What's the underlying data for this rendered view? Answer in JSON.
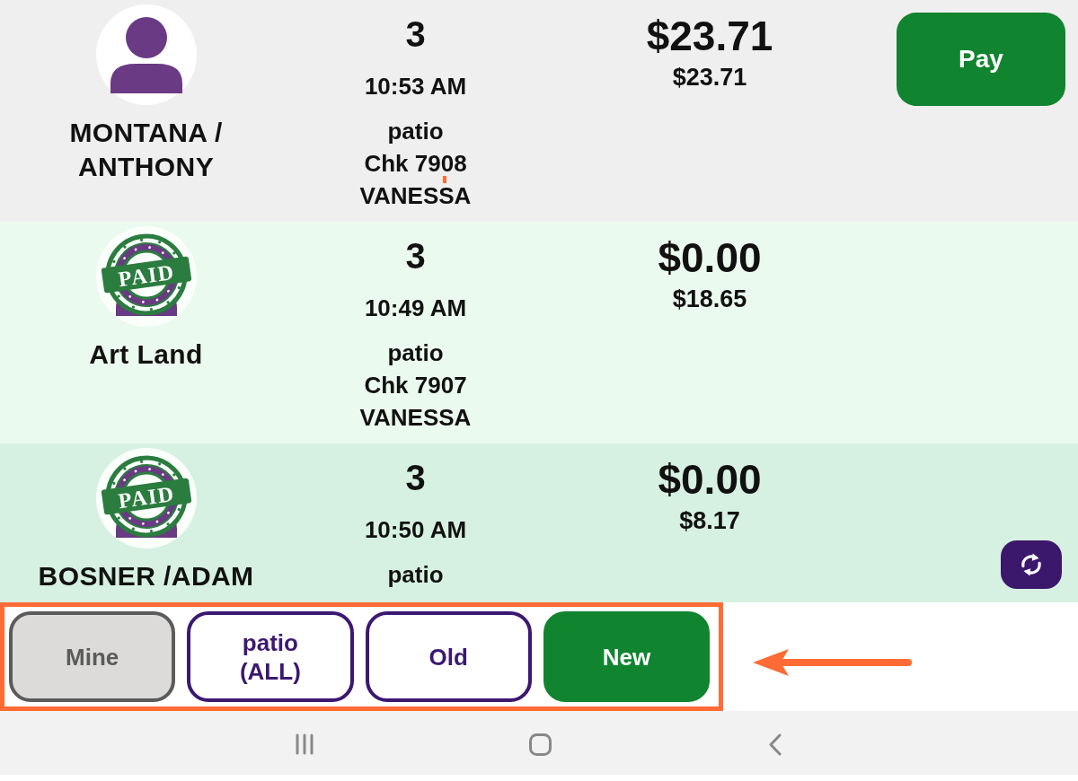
{
  "orders": [
    {
      "paid": false,
      "customer": "MONTANA / ANTHONY",
      "guests": "3",
      "time": "10:53 AM",
      "area": "patio",
      "check": "Chk 7908",
      "server": "VANESSA",
      "balance": "$23.71",
      "total": "$23.71",
      "pay_button": "Pay"
    },
    {
      "paid": true,
      "stamp": "PAID",
      "customer": "Art Land",
      "guests": "3",
      "time": "10:49 AM",
      "area": "patio",
      "check": "Chk 7907",
      "server": "VANESSA",
      "balance": "$0.00",
      "total": "$18.65"
    },
    {
      "paid": true,
      "stamp": "PAID",
      "customer": "BOSNER /ADAM",
      "guests": "3",
      "time": "10:50 AM",
      "area": "patio",
      "balance": "$0.00",
      "total": "$8.17"
    }
  ],
  "filter_buttons": [
    {
      "label": "Mine",
      "kind": "muted"
    },
    {
      "label": "patio (ALL)",
      "kind": "outline"
    },
    {
      "label": "Old",
      "kind": "outline"
    },
    {
      "label": "New",
      "kind": "primary"
    }
  ]
}
